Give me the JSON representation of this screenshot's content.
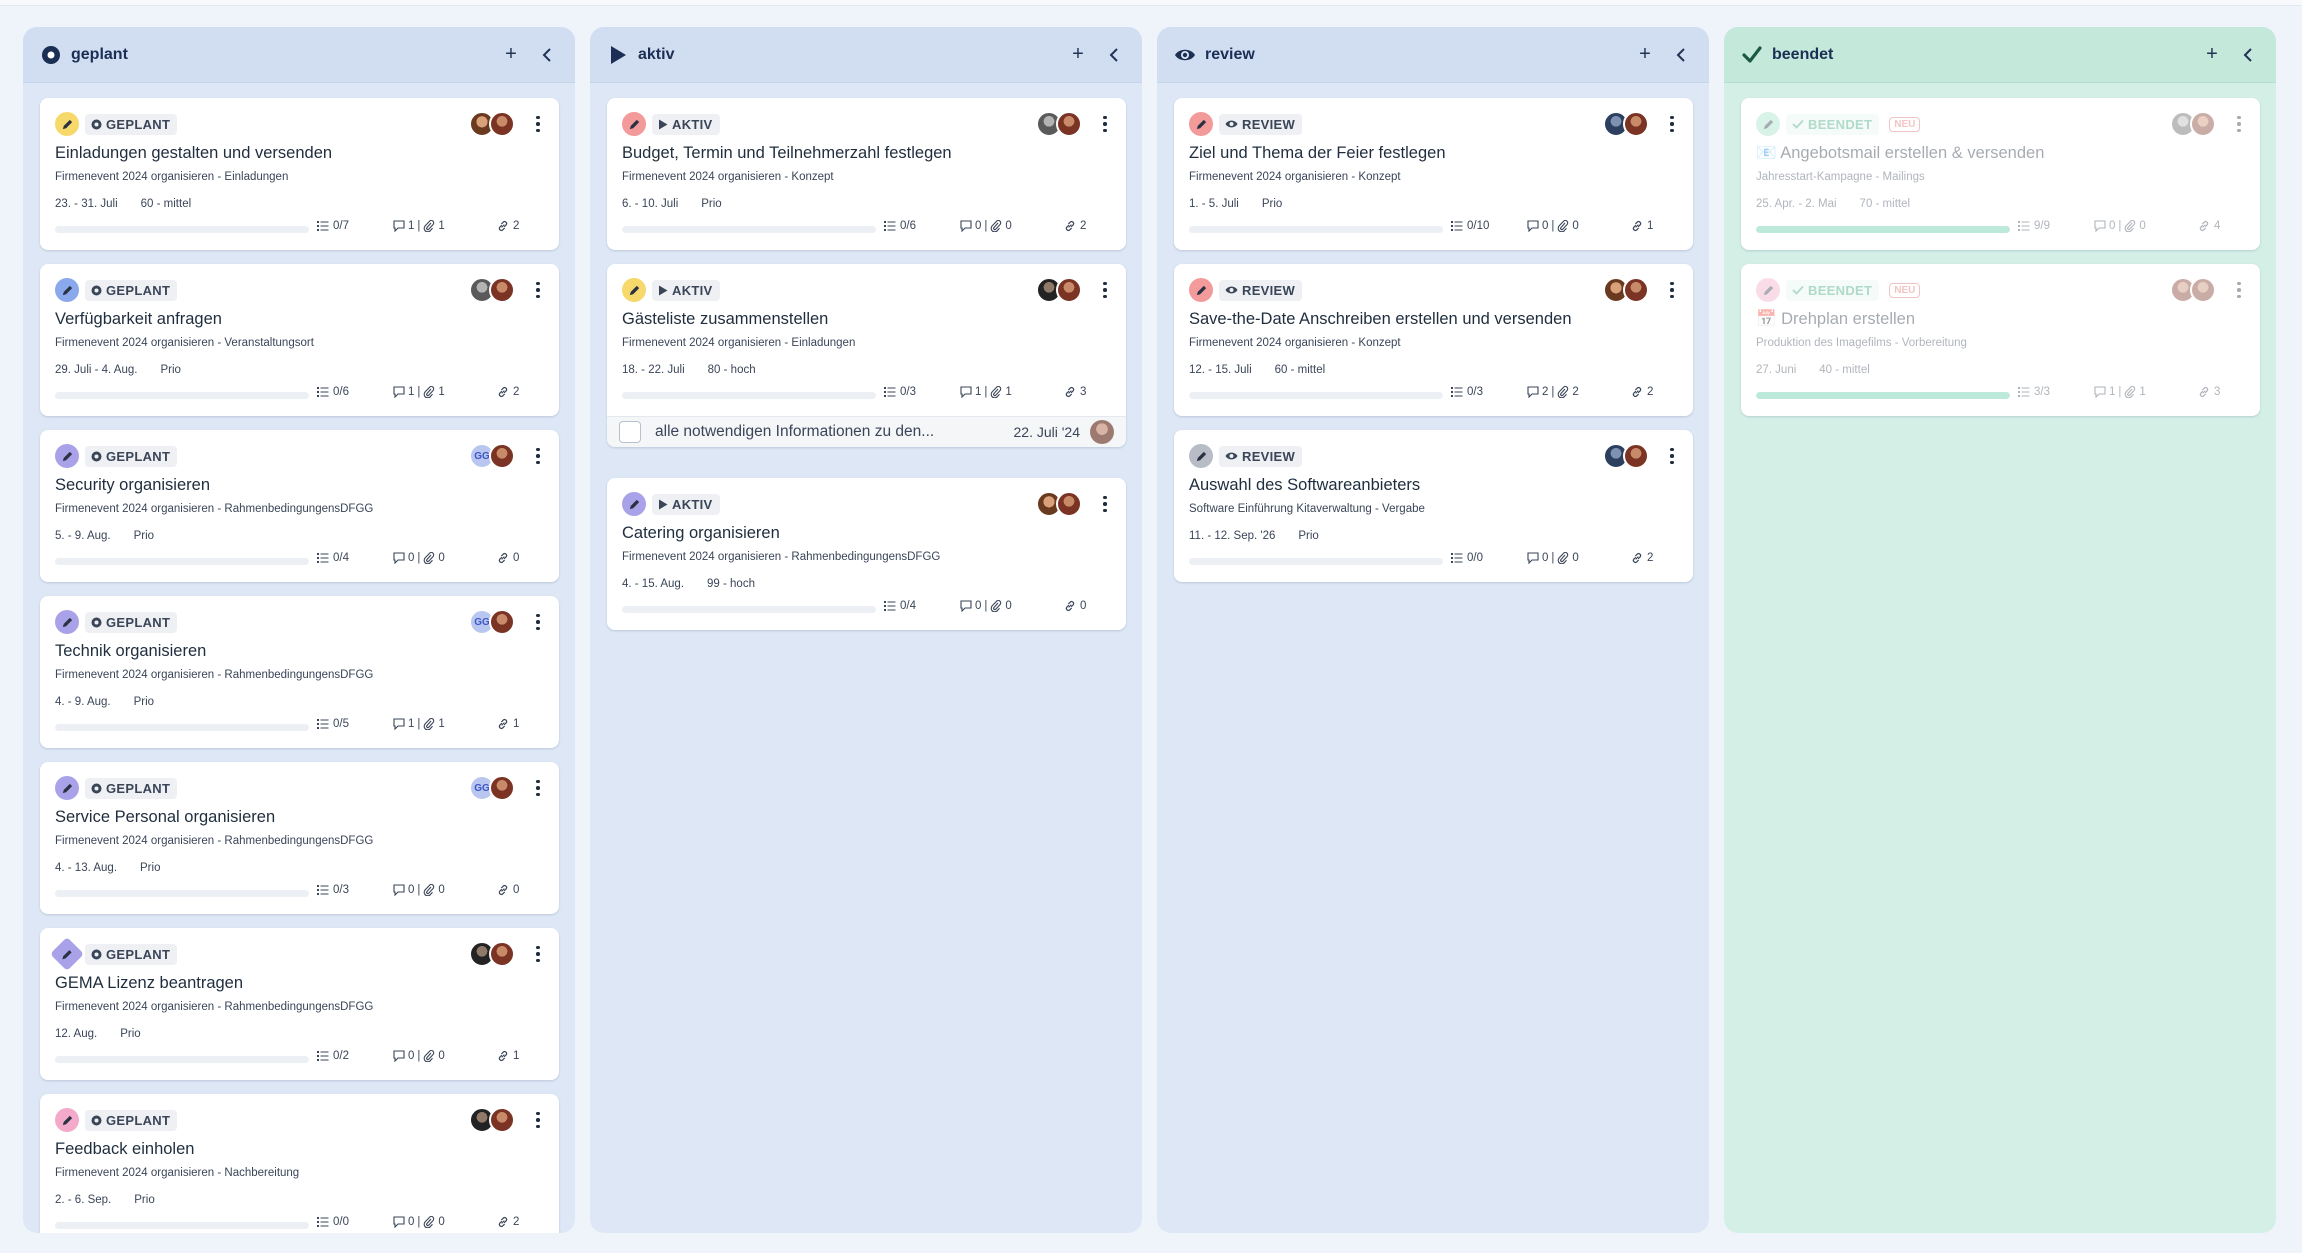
{
  "columns": [
    {
      "title": "geplant",
      "icon": "circle-dot-icon",
      "cards": [
        {
          "pen_color": "#f6d86b",
          "pen_shape": "circle",
          "status": "GEPLANT",
          "avatars": [
            "a1",
            "a2"
          ],
          "title": "Einladungen gestalten und versenden",
          "project": "Firmenevent 2024 organisieren - Einladungen",
          "date": "23. - 31. Juli",
          "meta": "60 - mittel",
          "progress": 0,
          "subtasks": "0/7",
          "comments": "1",
          "attachments": "1",
          "links": "2"
        },
        {
          "pen_color": "#8aa8ec",
          "pen_shape": "circle",
          "status": "GEPLANT",
          "avatars": [
            "a3",
            "a2"
          ],
          "title": "Verfügbarkeit anfragen",
          "project": "Firmenevent 2024 organisieren - Veranstaltungsort",
          "date": "29. Juli - 4. Aug.",
          "meta": "Prio",
          "progress": 0,
          "subtasks": "0/6",
          "comments": "1",
          "attachments": "1",
          "links": "2"
        },
        {
          "pen_color": "#aaa2e8",
          "pen_shape": "circle",
          "status": "GEPLANT",
          "avatars": [
            "gg",
            "a2"
          ],
          "title": "Security organisieren",
          "project": "Firmenevent 2024 organisieren - RahmenbedingungensDFGG",
          "date": "5. - 9. Aug.",
          "meta": "Prio",
          "progress": 0,
          "subtasks": "0/4",
          "comments": "0",
          "attachments": "0",
          "links": "0"
        },
        {
          "pen_color": "#aaa2e8",
          "pen_shape": "circle",
          "status": "GEPLANT",
          "avatars": [
            "gg",
            "a2"
          ],
          "title": "Technik organisieren",
          "project": "Firmenevent 2024 organisieren - RahmenbedingungensDFGG",
          "date": "4. - 9. Aug.",
          "meta": "Prio",
          "progress": 0,
          "subtasks": "0/5",
          "comments": "1",
          "attachments": "1",
          "links": "1"
        },
        {
          "pen_color": "#aaa2e8",
          "pen_shape": "circle",
          "status": "GEPLANT",
          "avatars": [
            "gg",
            "a2"
          ],
          "title": "Service Personal organisieren",
          "project": "Firmenevent 2024 organisieren - RahmenbedingungensDFGG",
          "date": "4. - 13. Aug.",
          "meta": "Prio",
          "progress": 0,
          "subtasks": "0/3",
          "comments": "0",
          "attachments": "0",
          "links": "0"
        },
        {
          "pen_color": "#aaa2e8",
          "pen_shape": "diamond",
          "status": "GEPLANT",
          "avatars": [
            "a5",
            "a2"
          ],
          "title": "GEMA Lizenz beantragen",
          "project": "Firmenevent 2024 organisieren - RahmenbedingungensDFGG",
          "date": "12. Aug.",
          "meta": "Prio",
          "progress": 0,
          "subtasks": "0/2",
          "comments": "0",
          "attachments": "0",
          "links": "1"
        },
        {
          "pen_color": "#f3a9c9",
          "pen_shape": "circle",
          "status": "GEPLANT",
          "avatars": [
            "a5",
            "a2"
          ],
          "title": "Feedback einholen",
          "project": "Firmenevent 2024 organisieren - Nachbereitung",
          "date": "2. - 6. Sep.",
          "meta": "Prio",
          "progress": 0,
          "subtasks": "0/0",
          "comments": "0",
          "attachments": "0",
          "links": "2"
        }
      ]
    },
    {
      "title": "aktiv",
      "icon": "play-icon",
      "cards": [
        {
          "pen_color": "#f39a9a",
          "pen_shape": "circle",
          "status": "AKTIV",
          "avatars": [
            "a3",
            "a2"
          ],
          "title": "Budget, Termin und Teilnehmerzahl festlegen",
          "project": "Firmenevent 2024 organisieren - Konzept",
          "date": "6. - 10. Juli",
          "meta": "Prio",
          "progress": 0,
          "subtasks": "0/6",
          "comments": "0",
          "attachments": "0",
          "links": "2"
        },
        {
          "pen_color": "#f6d86b",
          "pen_shape": "circle",
          "status": "AKTIV",
          "avatars": [
            "a5",
            "a2"
          ],
          "title": "Gästeliste zusammenstellen",
          "project": "Firmenevent 2024 organisieren - Einladungen",
          "date": "18. - 22. Juli",
          "meta": "80 - hoch",
          "progress": 0,
          "subtasks": "0/3",
          "comments": "1",
          "attachments": "1",
          "links": "3",
          "subtask": {
            "text": "alle notwendigen Informationen zu den...",
            "date": "22. Juli '24"
          }
        },
        {
          "pen_color": "#aaa2e8",
          "pen_shape": "circle",
          "status": "AKTIV",
          "avatars": [
            "a1",
            "a2"
          ],
          "title": "Catering organisieren",
          "project": "Firmenevent 2024 organisieren - RahmenbedingungensDFGG",
          "date": "4. - 15. Aug.",
          "meta": "99 - hoch",
          "progress": 0,
          "subtasks": "0/4",
          "comments": "0",
          "attachments": "0",
          "links": "0"
        }
      ]
    },
    {
      "title": "review",
      "icon": "eye-icon",
      "cards": [
        {
          "pen_color": "#f39a9a",
          "pen_shape": "circle",
          "status": "REVIEW",
          "avatars": [
            "a4",
            "a2"
          ],
          "title": "Ziel und Thema der Feier festlegen",
          "project": "Firmenevent 2024 organisieren - Konzept",
          "date": "1. - 5. Juli",
          "meta": "Prio",
          "progress": 0,
          "subtasks": "0/10",
          "comments": "0",
          "attachments": "0",
          "links": "1"
        },
        {
          "pen_color": "#f39a9a",
          "pen_shape": "circle",
          "status": "REVIEW",
          "avatars": [
            "a1",
            "a2"
          ],
          "title": "Save-the-Date Anschreiben erstellen und versenden",
          "project": "Firmenevent 2024 organisieren - Konzept",
          "date": "12. - 15. Juli",
          "meta": "60 - mittel",
          "progress": 0,
          "subtasks": "0/3",
          "comments": "2",
          "attachments": "2",
          "links": "2"
        },
        {
          "pen_color": "#b7bcc6",
          "pen_shape": "circle",
          "status": "REVIEW",
          "avatars": [
            "a4",
            "a2"
          ],
          "title": "Auswahl des Softwareanbieters",
          "project": "Software Einführung Kitaverwaltung - Vergabe",
          "date": "11. - 12. Sep. '26",
          "meta": "Prio",
          "progress": 0,
          "subtasks": "0/0",
          "comments": "0",
          "attachments": "0",
          "links": "2"
        }
      ]
    },
    {
      "title": "beendet",
      "icon": "check-icon",
      "cards": [
        {
          "pen_color": "#9fe0c4",
          "pen_shape": "circle",
          "status": "BEENDET",
          "neu": "NEU",
          "avatars": [
            "a3",
            "a2"
          ],
          "title": "📧 Angebotsmail erstellen & versenden",
          "project": "Jahresstart-Kampagne - Mailings",
          "date": "25. Apr. - 2. Mai",
          "meta": "70 - mittel",
          "progress": 1,
          "subtasks": "9/9",
          "comments": "0",
          "attachments": "0",
          "links": "4"
        },
        {
          "pen_color": "#f3a9c9",
          "pen_shape": "circle",
          "status": "BEENDET",
          "neu": "NEU",
          "avatars": [
            "a2",
            "a2"
          ],
          "title": "📅 Drehplan erstellen",
          "project": "Produktion des Imagefilms - Vorbereitung",
          "date": "27. Juni",
          "meta": "40 - mittel",
          "progress": 1,
          "subtasks": "3/3",
          "comments": "1",
          "attachments": "1",
          "links": "3"
        }
      ]
    }
  ]
}
